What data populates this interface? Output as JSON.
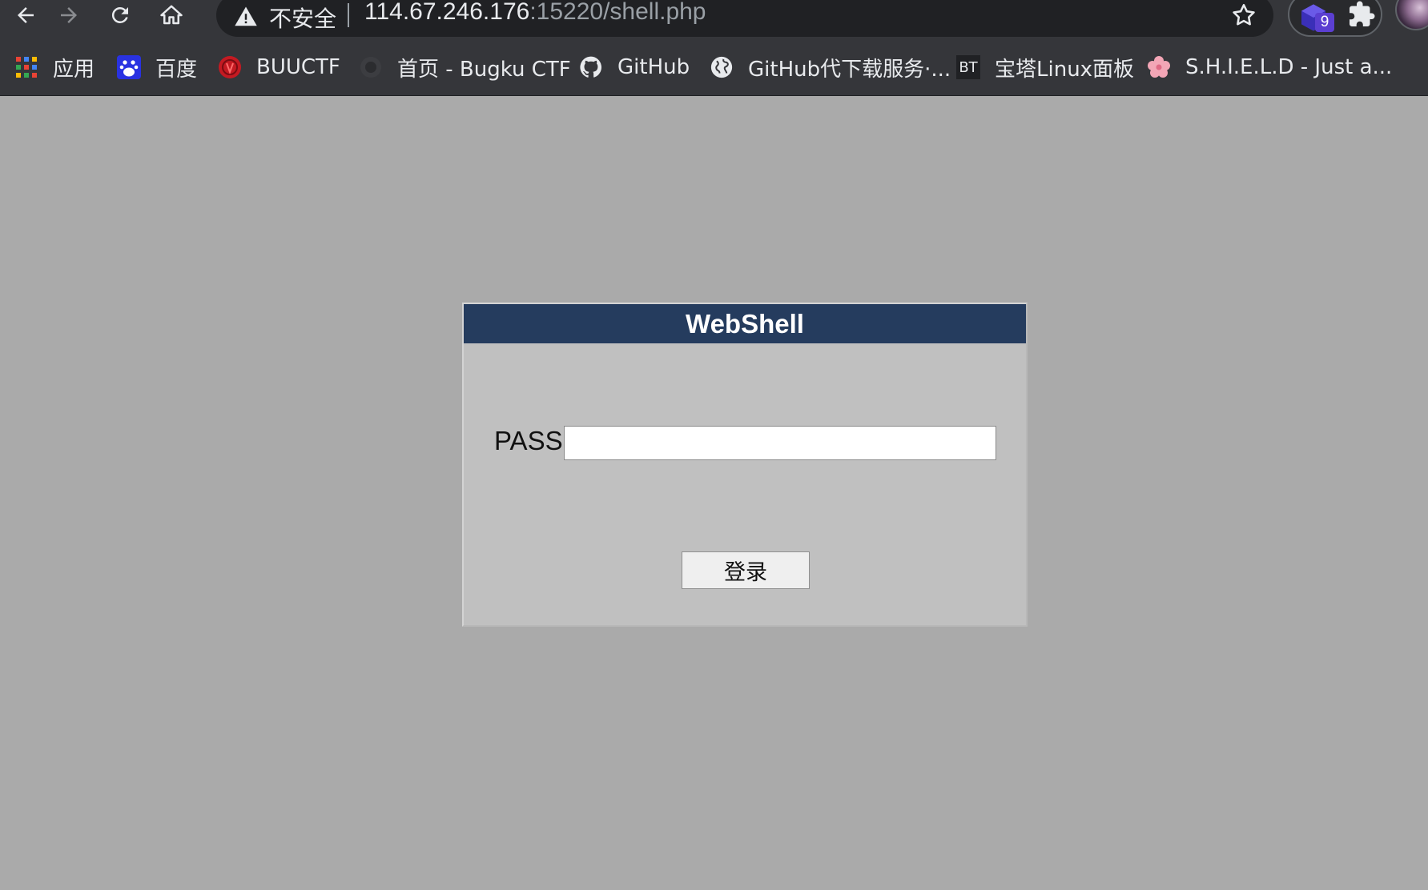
{
  "browser": {
    "omnibox": {
      "security_label": "不安全",
      "url_host": "114.67.246.176",
      "url_rest": ":15220/shell.php"
    },
    "extensions": {
      "badge_count": "9"
    }
  },
  "bookmarks": [
    {
      "label": "应用",
      "icon": "apps-grid-icon"
    },
    {
      "label": "百度",
      "icon": "baidu-icon"
    },
    {
      "label": "BUUCTF",
      "icon": "buuctf-icon"
    },
    {
      "label": "首页 - Bugku CTF",
      "icon": "bugku-icon"
    },
    {
      "label": "GitHub",
      "icon": "github-icon"
    },
    {
      "label": "GitHub代下载服务·...",
      "icon": "globe-icon"
    },
    {
      "label": "宝塔Linux面板",
      "icon": "bt-icon",
      "icon_text": "BT"
    },
    {
      "label": "S.H.I.E.L.D - Just a...",
      "icon": "flower-icon"
    }
  ],
  "form": {
    "title": "WebShell",
    "pass_label": "PASS:",
    "pass_value": "",
    "submit_label": "登录"
  },
  "colors": {
    "page_bg": "#aaaaaa",
    "panel_bg": "#c0c0c0",
    "title_bar": "#253c5e",
    "chrome_bg": "#35363a"
  }
}
